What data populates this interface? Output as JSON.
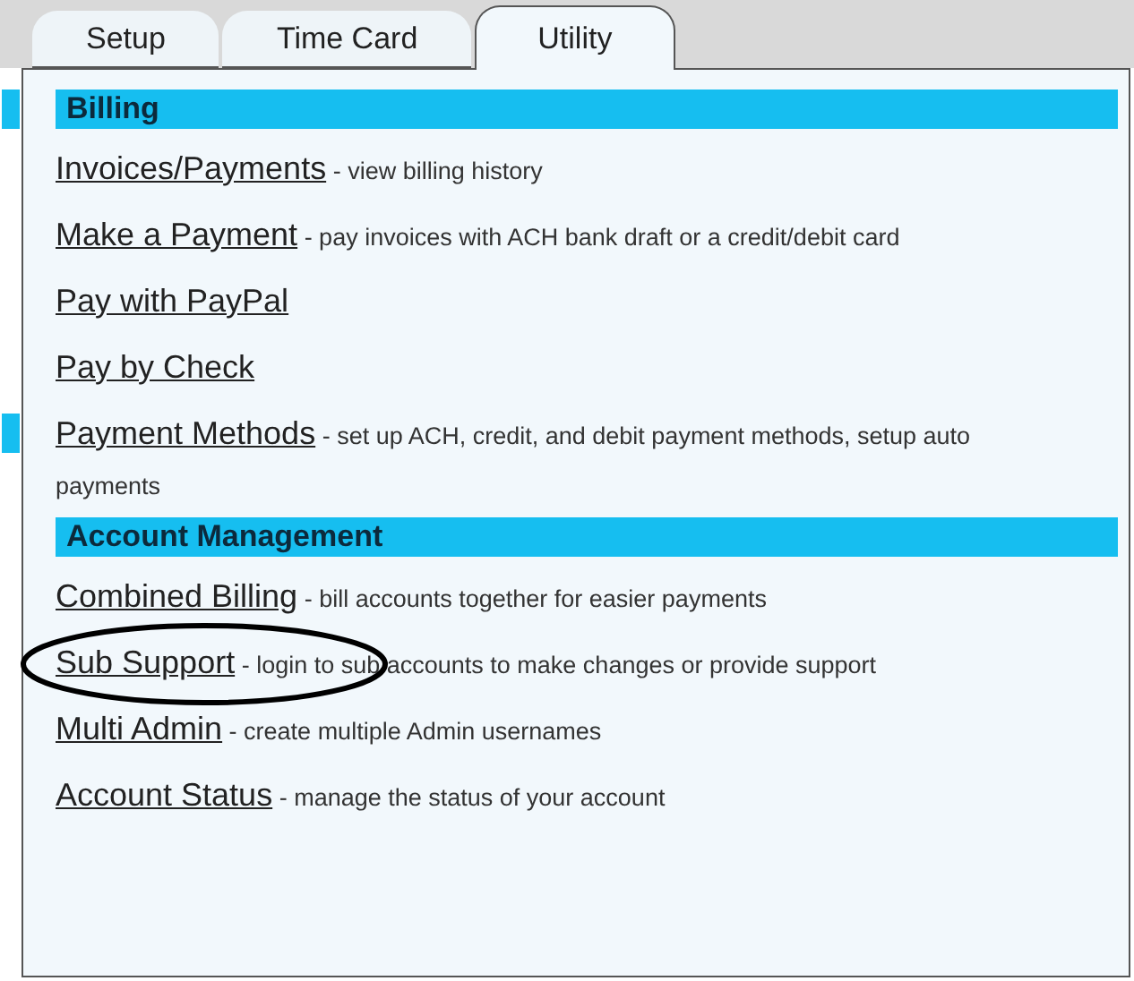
{
  "tabs": [
    {
      "label": "Setup",
      "selected": false
    },
    {
      "label": "Time Card",
      "selected": false
    },
    {
      "label": "Utility",
      "selected": true
    }
  ],
  "sections": [
    {
      "title": "Billing",
      "marked": true,
      "items": [
        {
          "link": "Invoices/Payments",
          "description": "- view billing history",
          "marked": false,
          "circled": false
        },
        {
          "link": "Make a Payment",
          "description": "- pay invoices with ACH bank draft or a credit/debit card",
          "marked": false,
          "circled": false
        },
        {
          "link": "Pay with PayPal",
          "marked": false,
          "circled": false
        },
        {
          "link": "Pay by Check",
          "marked": false,
          "circled": false
        },
        {
          "link": "Payment Methods",
          "description": "- set up ACH, credit, and debit payment methods, setup auto payments",
          "marked": true,
          "circled": false
        }
      ]
    },
    {
      "title": "Account Management",
      "marked": false,
      "items": [
        {
          "link": "Combined Billing",
          "description": "- bill accounts together for easier payments",
          "marked": false,
          "circled": false
        },
        {
          "link": "Sub Support",
          "description": "- login to sub accounts to make changes or provide support",
          "marked": false,
          "circled": true
        },
        {
          "link": "Multi Admin",
          "description": "- create multiple Admin usernames",
          "marked": false,
          "circled": false
        },
        {
          "link": "Account Status",
          "description": "- manage the status of your account",
          "marked": false,
          "circled": false
        }
      ]
    }
  ]
}
